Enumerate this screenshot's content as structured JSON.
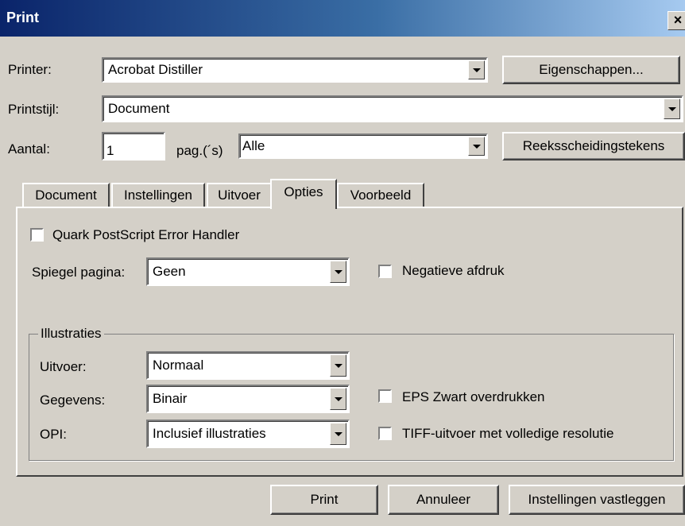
{
  "window": {
    "title": "Print",
    "close_glyph": "×"
  },
  "printer": {
    "label": "Printer:",
    "value": "Acrobat Distiller",
    "properties_button": "Eigenschappen..."
  },
  "printstyle": {
    "label": "Printstijl:",
    "value": "Document"
  },
  "copies": {
    "label": "Aantal:",
    "value": "1",
    "pages_label": "pag.(´s)",
    "pages_value": "Alle",
    "separators_button": "Reeksscheidingstekens"
  },
  "tabs": [
    {
      "label": "Document",
      "active": false
    },
    {
      "label": "Instellingen",
      "active": false
    },
    {
      "label": "Uitvoer",
      "active": false
    },
    {
      "label": "Opties",
      "active": true
    },
    {
      "label": "Voorbeeld",
      "active": false
    }
  ],
  "options": {
    "quark_handler": {
      "label": "Quark PostScript Error Handler",
      "checked": false
    },
    "mirror": {
      "label": "Spiegel pagina:",
      "value": "Geen"
    },
    "negative": {
      "label": "Negatieve afdruk",
      "checked": false
    },
    "illustrations": {
      "legend": "Illustraties",
      "output": {
        "label": "Uitvoer:",
        "value": "Normaal"
      },
      "data": {
        "label": "Gegevens:",
        "value": "Binair"
      },
      "opi": {
        "label": "OPI:",
        "value": "Inclusief illustraties"
      },
      "eps_overprint": {
        "label": "EPS Zwart overdrukken",
        "checked": false
      },
      "tiff_full": {
        "label": "TIFF-uitvoer met volledige resolutie",
        "checked": false
      }
    }
  },
  "footer": {
    "print_button": "Print",
    "cancel_button": "Annuleer",
    "capture_button": "Instellingen vastleggen"
  }
}
